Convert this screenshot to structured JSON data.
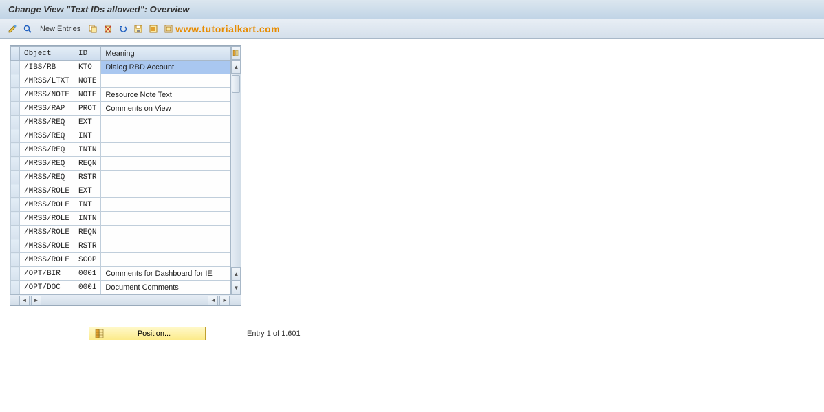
{
  "title": "Change View \"Text IDs allowed\": Overview",
  "toolbar": {
    "new_entries_label": "New Entries"
  },
  "watermark": "www.tutorialkart.com",
  "grid": {
    "headers": {
      "object": "Object",
      "id": "ID",
      "meaning": "Meaning"
    },
    "rows": [
      {
        "object": "/IBS/RB",
        "id": "KTO",
        "meaning": "Dialog RBD Account",
        "highlight": true
      },
      {
        "object": "/MRSS/LTXT",
        "id": "NOTE",
        "meaning": ""
      },
      {
        "object": "/MRSS/NOTE",
        "id": "NOTE",
        "meaning": "Resource Note Text"
      },
      {
        "object": "/MRSS/RAP",
        "id": "PROT",
        "meaning": "Comments on View"
      },
      {
        "object": "/MRSS/REQ",
        "id": "EXT",
        "meaning": ""
      },
      {
        "object": "/MRSS/REQ",
        "id": "INT",
        "meaning": ""
      },
      {
        "object": "/MRSS/REQ",
        "id": "INTN",
        "meaning": ""
      },
      {
        "object": "/MRSS/REQ",
        "id": "REQN",
        "meaning": ""
      },
      {
        "object": "/MRSS/REQ",
        "id": "RSTR",
        "meaning": ""
      },
      {
        "object": "/MRSS/ROLE",
        "id": "EXT",
        "meaning": ""
      },
      {
        "object": "/MRSS/ROLE",
        "id": "INT",
        "meaning": ""
      },
      {
        "object": "/MRSS/ROLE",
        "id": "INTN",
        "meaning": ""
      },
      {
        "object": "/MRSS/ROLE",
        "id": "REQN",
        "meaning": ""
      },
      {
        "object": "/MRSS/ROLE",
        "id": "RSTR",
        "meaning": ""
      },
      {
        "object": "/MRSS/ROLE",
        "id": "SCOP",
        "meaning": ""
      },
      {
        "object": "/OPT/BIR",
        "id": "0001",
        "meaning": "Comments for Dashboard for IE"
      },
      {
        "object": "/OPT/DOC",
        "id": "0001",
        "meaning": "Document Comments"
      }
    ]
  },
  "footer": {
    "position_label": "Position...",
    "entry_status": "Entry 1 of 1.601"
  }
}
